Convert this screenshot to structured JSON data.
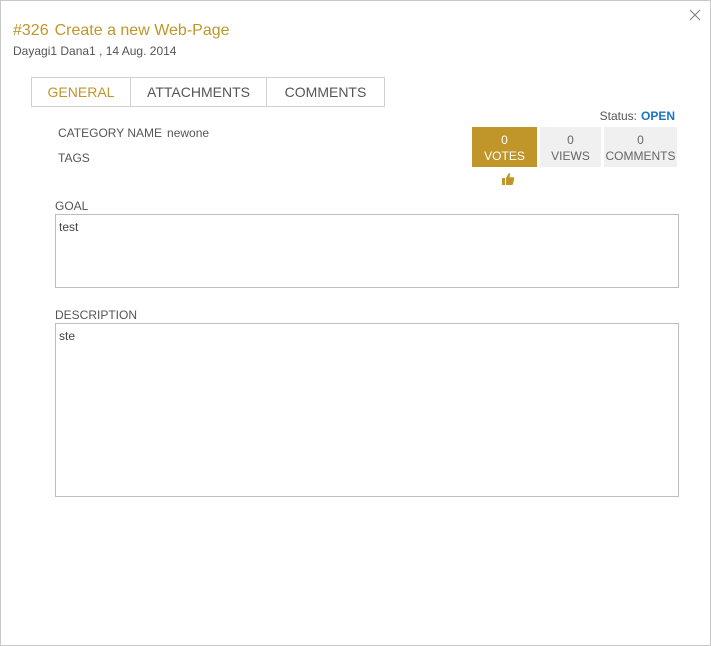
{
  "header": {
    "issue_id": "#326",
    "title": "Create a new Web-Page",
    "meta": "Dayagi1 Dana1 , 14 Aug. 2014"
  },
  "tabs": [
    {
      "label": "GENERAL",
      "active": true
    },
    {
      "label": "ATTACHMENTS",
      "active": false
    },
    {
      "label": "COMMENTS",
      "active": false
    }
  ],
  "status": {
    "label": "Status:",
    "value": "OPEN"
  },
  "fields": {
    "category_label": "CATEGORY NAME",
    "category_value": "newone",
    "tags_label": "TAGS"
  },
  "stats": {
    "votes": {
      "count": "0",
      "label": "VOTES"
    },
    "views": {
      "count": "0",
      "label": "VIEWS"
    },
    "comments": {
      "count": "0",
      "label": "COMMENTS"
    }
  },
  "goal": {
    "label": "GOAL",
    "value": "test"
  },
  "description": {
    "label": "DESCRIPTION",
    "value": "ste"
  },
  "icons": {
    "close": "close-icon",
    "vote": "thumbs-up-icon"
  },
  "colors": {
    "accent": "#c0962a",
    "status": "#1a73c5",
    "stat_bg": "#f0f0f0"
  }
}
